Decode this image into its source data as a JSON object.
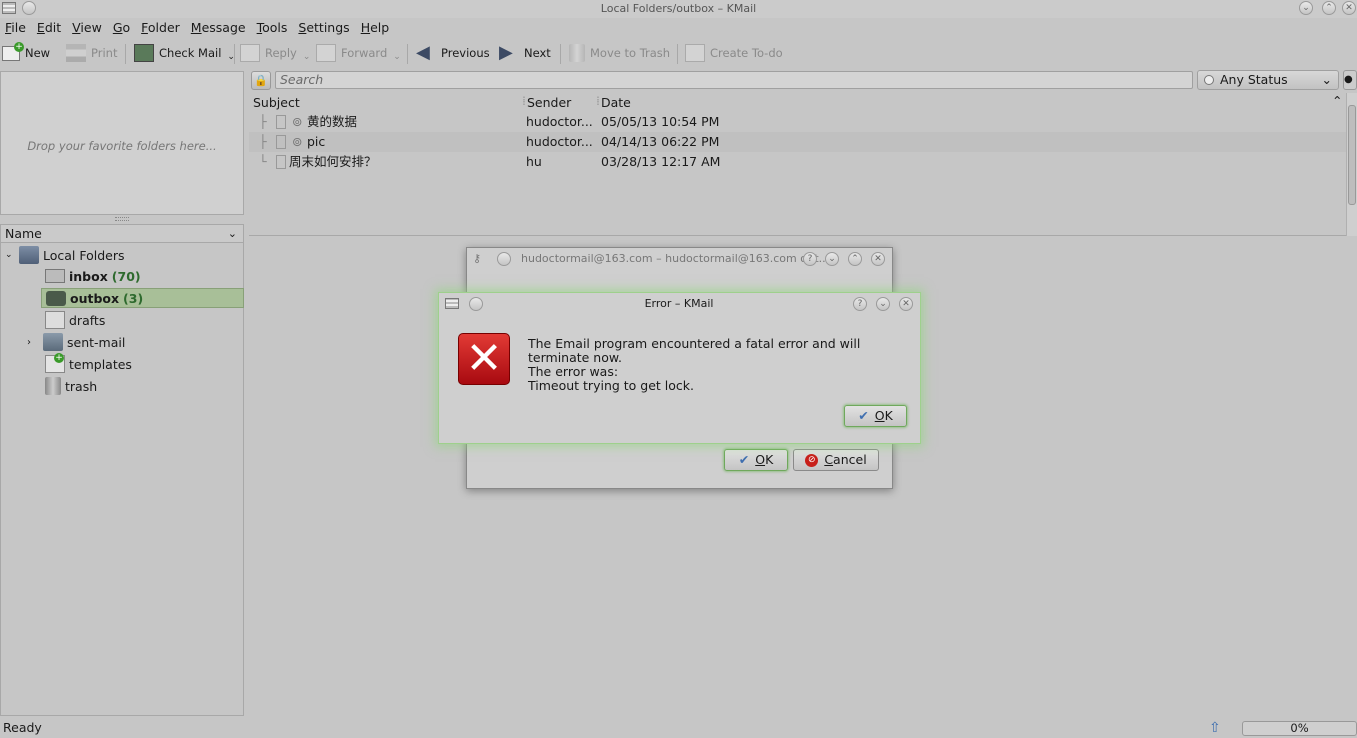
{
  "window": {
    "title": "Local Folders/outbox – KMail"
  },
  "menu": [
    "File",
    "Edit",
    "View",
    "Go",
    "Folder",
    "Message",
    "Tools",
    "Settings",
    "Help"
  ],
  "toolbar": {
    "new": "New",
    "print": "Print",
    "check_mail": "Check Mail",
    "reply": "Reply",
    "forward": "Forward",
    "previous": "Previous",
    "next": "Next",
    "move_to_trash": "Move to Trash",
    "create_todo": "Create To-do"
  },
  "favorites": {
    "placeholder": "Drop your favorite folders here..."
  },
  "folder_tree": {
    "header": "Name",
    "root": "Local Folders",
    "items": [
      {
        "name": "inbox",
        "count": "(70)"
      },
      {
        "name": "outbox",
        "count": "(3)"
      },
      {
        "name": "drafts",
        "count": ""
      },
      {
        "name": "sent-mail",
        "count": ""
      },
      {
        "name": "templates",
        "count": ""
      },
      {
        "name": "trash",
        "count": ""
      }
    ]
  },
  "search": {
    "placeholder": "Search",
    "status_filter": "Any Status"
  },
  "message_list": {
    "columns": [
      "Subject",
      "Sender",
      "Date"
    ],
    "rows": [
      {
        "subject": "黄的数据",
        "sender": "hudoctor...",
        "date": "05/05/13 10:54 PM"
      },
      {
        "subject": "pic",
        "sender": "hudoctor...",
        "date": "04/14/13 06:22 PM"
      },
      {
        "subject": "周末如何安排？",
        "sender": "hu",
        "date": "03/28/13 12:17 AM"
      }
    ]
  },
  "back_dialog": {
    "title": "hudoctormail@163.com – hudoctormail@163.com of t...",
    "ok": "OK",
    "cancel": "Cancel"
  },
  "error_dialog": {
    "title": "Error – KMail",
    "line1": "The Email program encountered a fatal error and will terminate now.",
    "line2": "The error was:",
    "line3": "Timeout trying to get lock.",
    "ok": "OK"
  },
  "statusbar": {
    "text": "Ready",
    "progress": "0%"
  },
  "colors": {
    "background": "#c6c6c6",
    "error_red": "#c8101a",
    "focus_glow": "#8cd778"
  }
}
